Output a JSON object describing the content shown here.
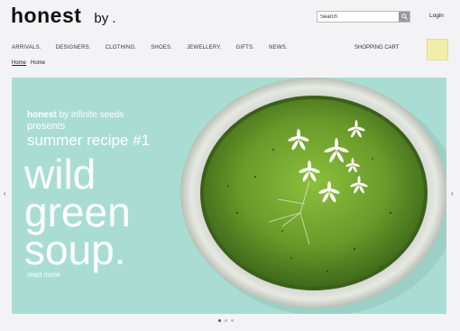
{
  "header": {
    "logo": "honest",
    "logo_suffix": "by .",
    "search_placeholder": "Search",
    "login": "Login"
  },
  "nav": {
    "items": [
      "ARRIVALS.",
      "DESIGNERS.",
      "CLOTHING.",
      "SHOES.",
      "JEWELLERY.",
      "GIFTS.",
      "NEWS."
    ],
    "cart": "SHOPPING CART"
  },
  "breadcrumb": {
    "link": "Home",
    "current": "Home"
  },
  "hero": {
    "brand": "honest",
    "brand_by": "by",
    "brand_partner": "infinite seeds",
    "presents": "presents",
    "recipe": "summer recipe #1",
    "title_lines": [
      "wild",
      "green",
      "soup."
    ],
    "read_more": "read more"
  },
  "carousel": {
    "prev_icon": "chevron-left-icon",
    "next_icon": "chevron-right-icon",
    "slide_count": 3,
    "active_slide": 1
  },
  "colors": {
    "hero_bg": "#a9ddd3",
    "soup": "#6a9a2a",
    "cart_box": "#efeeaa"
  }
}
